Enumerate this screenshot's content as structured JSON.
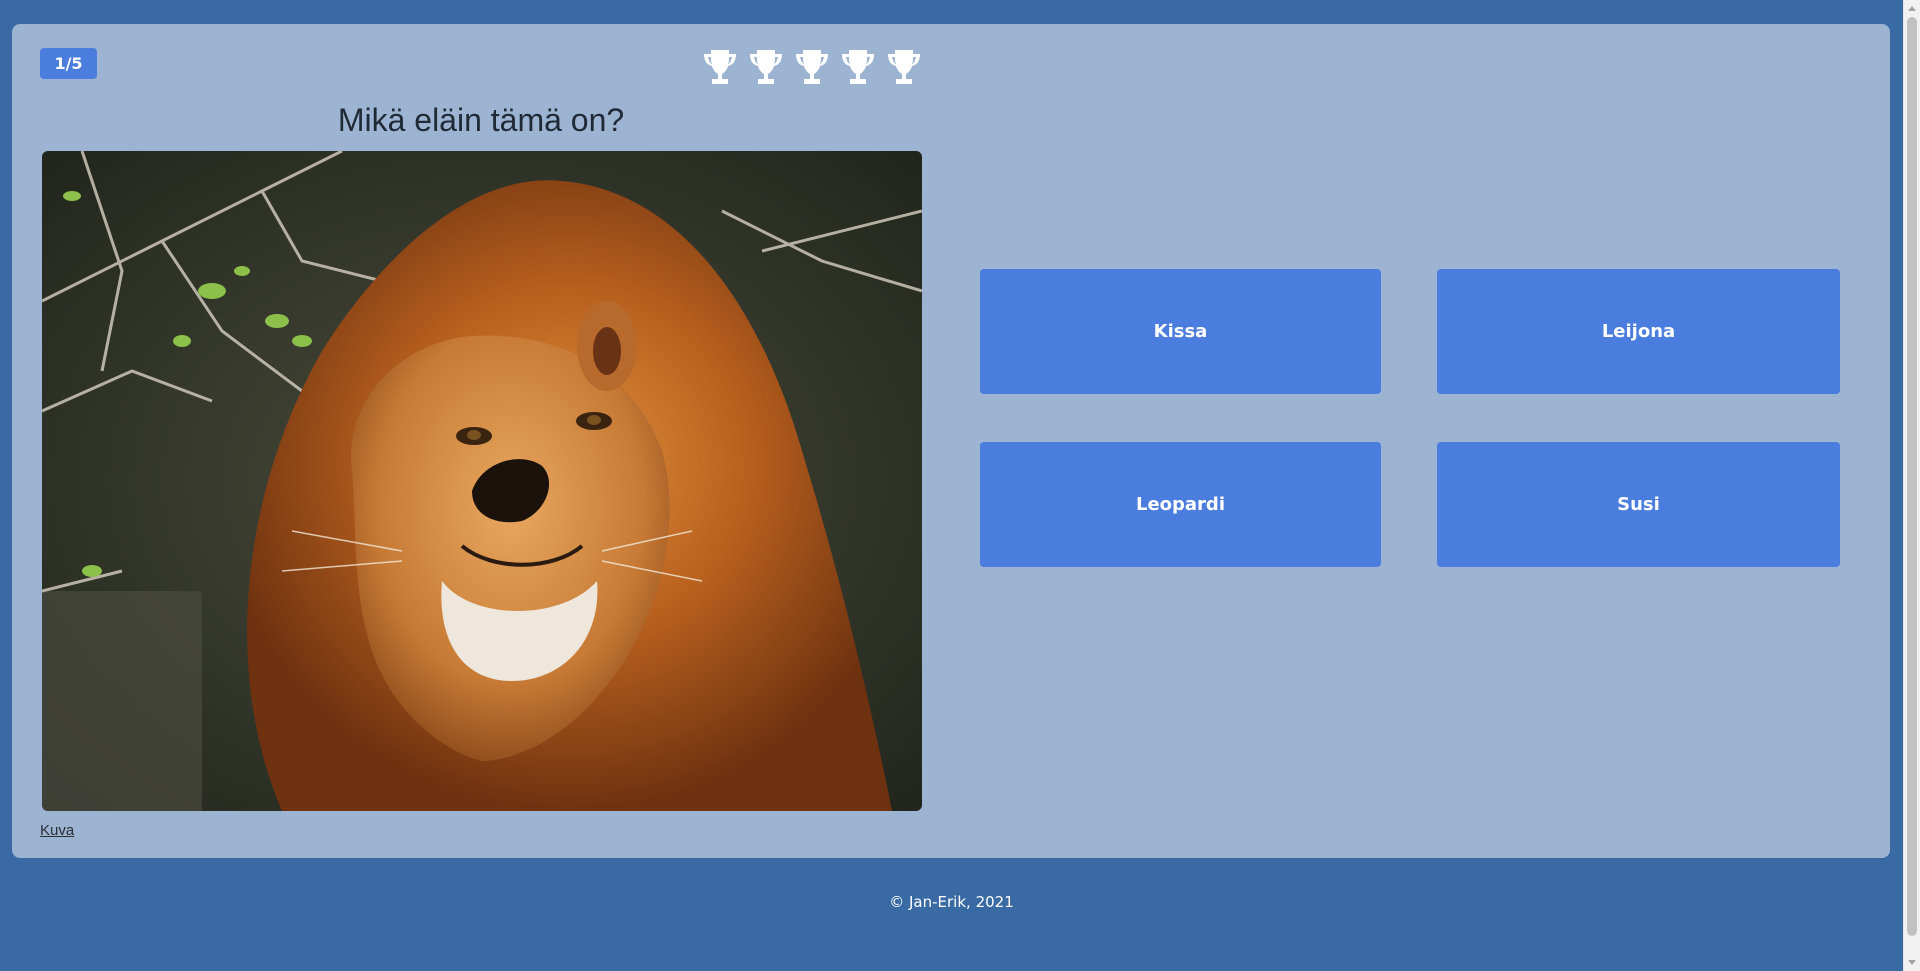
{
  "quiz": {
    "progress": "1/5",
    "question": "Mikä eläin tämä on?",
    "image_credit_link": "Kuva",
    "trophy_icon": "trophy-icon",
    "trophy_count": 5,
    "answers": [
      "Kissa",
      "Leijona",
      "Leopardi",
      "Susi"
    ]
  },
  "footer": {
    "copyright": "© Jan-Erik, 2021"
  },
  "colors": {
    "page_background": "#3a6aa3",
    "card_background": "#9cb3d2",
    "button": "#4a7dde",
    "text_light": "#ffffff"
  }
}
